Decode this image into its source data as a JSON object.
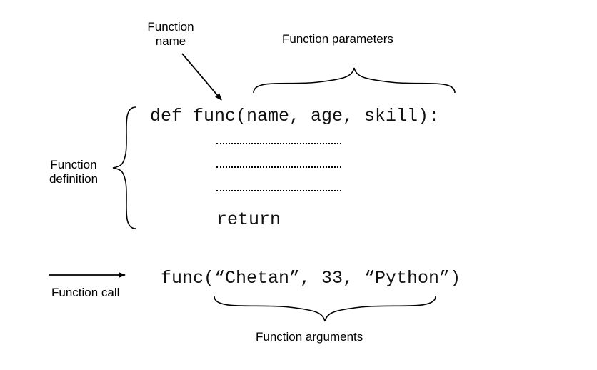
{
  "labels": {
    "function_name": "Function\nname",
    "function_parameters": "Function parameters",
    "function_definition": "Function\ndefinition",
    "function_call": "Function call",
    "function_arguments": "Function arguments"
  },
  "code": {
    "def_line": "def func(name, age, skill):",
    "return_line": "return",
    "call_line": "func(“Chetan”, 33, “Python”)"
  }
}
